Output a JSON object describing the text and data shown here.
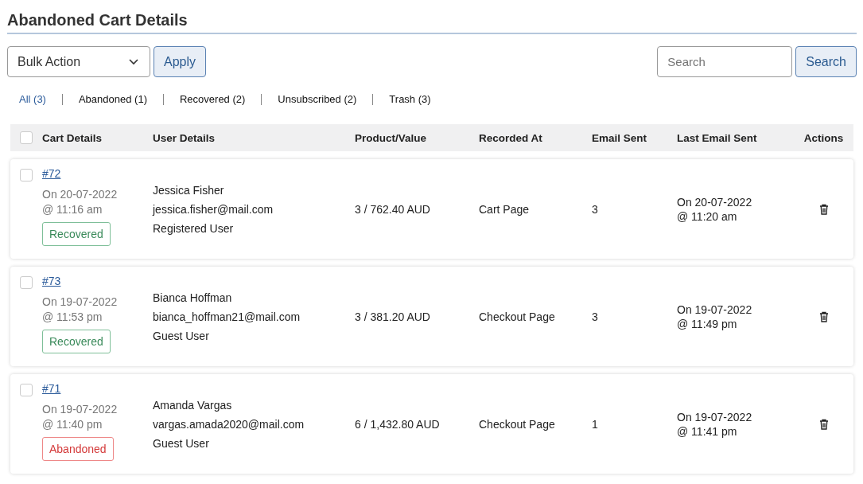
{
  "title": "Abandoned Cart Details",
  "bulk_action": {
    "value": "Bulk Action"
  },
  "apply_button": "Apply",
  "search": {
    "placeholder": "Search",
    "button": "Search"
  },
  "filters": [
    {
      "label": "All (3)",
      "selected": true
    },
    {
      "label": "Abandoned (1)",
      "selected": false
    },
    {
      "label": "Recovered (2)",
      "selected": false
    },
    {
      "label": "Unsubscribed (2)",
      "selected": false
    },
    {
      "label": "Trash (3)",
      "selected": false
    }
  ],
  "table": {
    "select_all_checked": false,
    "columns": [
      "Cart Details",
      "User Details",
      "Product/Value",
      "Recorded At",
      "Email Sent",
      "Last Email Sent",
      "Actions"
    ],
    "rows": [
      {
        "checked": false,
        "id": "#72",
        "date": "On 20-07-2022",
        "time": "@ 11:16 am",
        "status": {
          "kind": "recovered",
          "label": "Recovered"
        },
        "name": "Jessica Fisher",
        "email": "jessica.fisher@mail.com",
        "user_type": "Registered User",
        "product_value": "3 / 762.40 AUD",
        "recorded_at": "Cart Page",
        "email_sent": "3",
        "last_date": "On 20-07-2022",
        "last_time": "@ 11:20 am"
      },
      {
        "checked": false,
        "id": "#73",
        "date": "On 19-07-2022",
        "time": "@ 11:53 pm",
        "status": {
          "kind": "recovered",
          "label": "Recovered"
        },
        "name": "Bianca Hoffman",
        "email": "bianca_hoffman21@mail.com",
        "user_type": "Guest User",
        "product_value": "3 / 381.20 AUD",
        "recorded_at": "Checkout Page",
        "email_sent": "3",
        "last_date": "On 19-07-2022",
        "last_time": "@ 11:49 pm"
      },
      {
        "checked": false,
        "id": "#71",
        "date": "On 19-07-2022",
        "time": "@ 11:40 pm",
        "status": {
          "kind": "abandoned",
          "label": "Abandoned"
        },
        "name": "Amanda Vargas",
        "email": "vargas.amada2020@mail.com",
        "user_type": "Guest User",
        "product_value": "6 / 1,432.80 AUD",
        "recorded_at": "Checkout Page",
        "email_sent": "1",
        "last_date": "On 19-07-2022",
        "last_time": "@ 11:41 pm"
      }
    ]
  }
}
